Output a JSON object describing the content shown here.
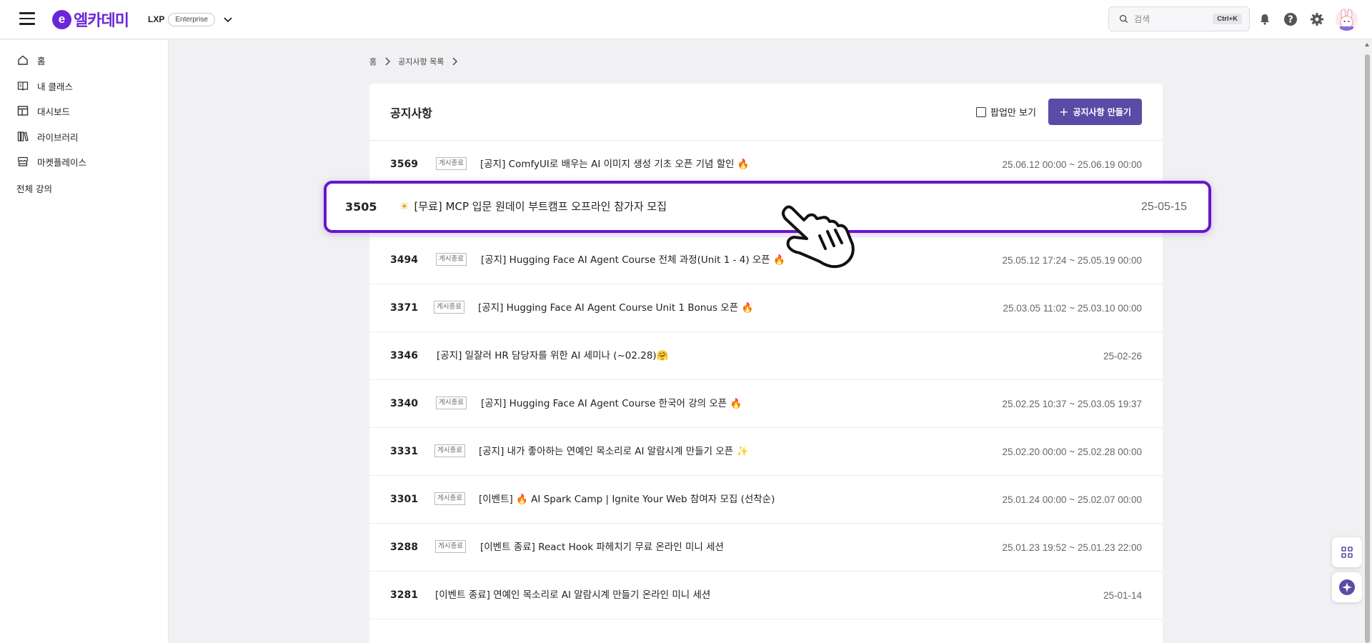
{
  "header": {
    "logo_mark": "e",
    "logo_text": "엘카데미",
    "workspace_name": "LXP",
    "workspace_badge": "Enterprise",
    "search_placeholder": "검색",
    "search_shortcut": "Ctrl+K",
    "icons": [
      "bell-icon",
      "help-icon",
      "gear-icon"
    ],
    "brand_color": "#6a27d8"
  },
  "sidebar": {
    "items": [
      {
        "label": "홈",
        "icon": "home-icon"
      },
      {
        "label": "내 클래스",
        "icon": "book-icon"
      },
      {
        "label": "대시보드",
        "icon": "dashboard-icon"
      },
      {
        "label": "라이브러리",
        "icon": "library-icon"
      },
      {
        "label": "마켓플레이스",
        "icon": "store-icon"
      }
    ],
    "all_courses": "전체 강의"
  },
  "breadcrumb": {
    "home": "홈",
    "current": "공지사항 목록"
  },
  "notice": {
    "title": "공지사항",
    "popup_only_label": "팝업만 보기",
    "popup_only_checked": false,
    "create_button": "공지사항 만들기",
    "button_color": "#5b4aa6"
  },
  "rows": [
    {
      "num": "3569",
      "badge": "게시종료",
      "title": "[공지] ComfyUI로 배우는 AI 이미지 생성 기초 오픈 기념 할인",
      "emoji": "🔥",
      "date": "25.06.12 00:00 ~ 25.06.19 00:00"
    },
    {
      "num": "3494",
      "badge": "게시종료",
      "title": "[공지] Hugging Face AI Agent Course 전체 과정(Unit 1 - 4) 오픈",
      "emoji": "🔥",
      "date": "25.05.12 17:24 ~ 25.05.19 00:00"
    },
    {
      "num": "3371",
      "badge": "게시종료",
      "title": "[공지] Hugging Face AI Agent Course Unit 1 Bonus 오픈",
      "emoji": "🔥",
      "date": "25.03.05 11:02 ~ 25.03.10 00:00"
    },
    {
      "num": "3346",
      "badge": "",
      "title": "[공지] 일잘러 HR 담당자를 위한 AI 세미나 (~02.28)",
      "emoji": "🤗",
      "date": "25-02-26"
    },
    {
      "num": "3340",
      "badge": "게시종료",
      "title": "[공지] Hugging Face AI Agent Course 한국어 강의 오픈",
      "emoji": "🔥",
      "date": "25.02.25 10:37 ~ 25.03.05 19:37"
    },
    {
      "num": "3331",
      "badge": "게시종료",
      "title": "[공지] 내가 좋아하는 연예인 목소리로 AI 알람시계 만들기 오픈",
      "emoji": "✨",
      "date": "25.02.20 00:00 ~ 25.02.28 00:00"
    },
    {
      "num": "3301",
      "badge": "게시종료",
      "title": "[이벤트] 🔥 AI Spark Camp | Ignite Your Web 참여자 모집 (선착순)",
      "emoji": "",
      "date": "25.01.24 00:00 ~ 25.02.07 00:00"
    },
    {
      "num": "3288",
      "badge": "게시종료",
      "title": "[이벤트 종료] React Hook 파헤치기 무료 온라인 미니 세션",
      "emoji": "",
      "date": "25.01.23 19:52 ~ 25.01.23 22:00"
    },
    {
      "num": "3281",
      "badge": "",
      "title": "[이벤트 종료] 연예인 목소리로 AI 알람시계 만들기 온라인 미니 세션",
      "emoji": "",
      "date": "25-01-14"
    }
  ],
  "highlighted_row": {
    "num": "3505",
    "emoji": "☀",
    "title": "[무료] MCP 입문 원데이 부트캠프 오프라인 참가자 모집",
    "date": "25-05-15",
    "border_color": "#6a14cc"
  }
}
